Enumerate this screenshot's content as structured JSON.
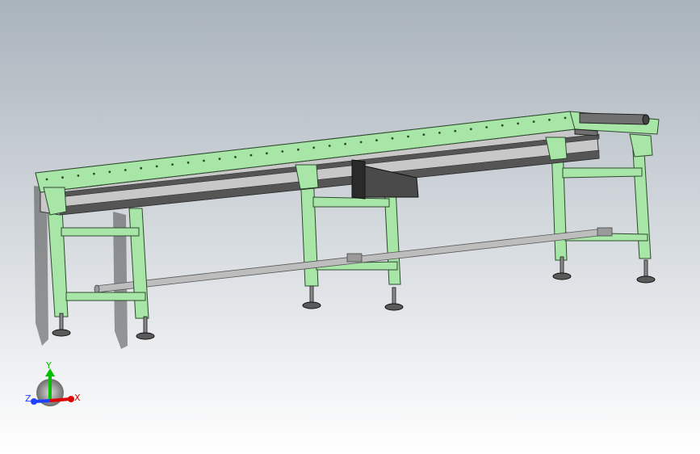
{
  "viewport": {
    "background_top": "#a9b3bc",
    "background_bottom": "#ffffff"
  },
  "model": {
    "frame_color": "#a8e6a8",
    "frame_dark": "#2e4a2e",
    "roller_color": "#707070",
    "rail_color": "#c8c8c8",
    "foot_color": "#5a5a5a"
  },
  "triad": {
    "y_label": "Y",
    "x_label": "X",
    "z_label": "Z",
    "y_color": "#00c000",
    "x_color": "#e00000",
    "z_color": "#2040ff"
  }
}
